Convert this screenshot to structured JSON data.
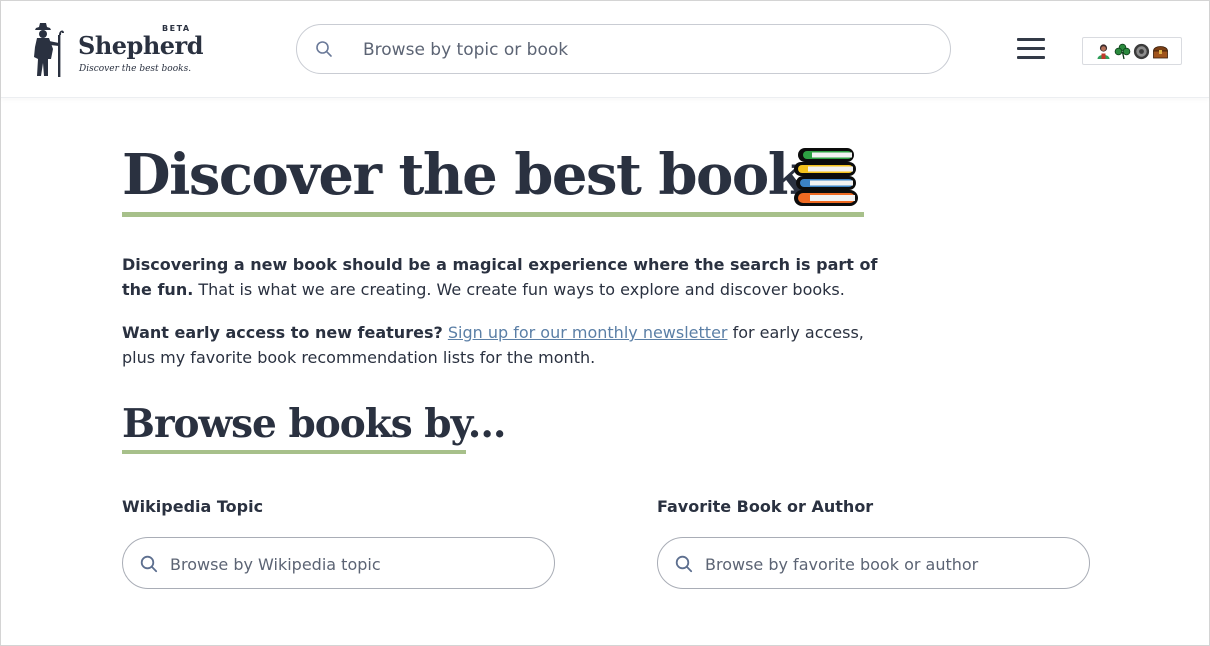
{
  "header": {
    "logo": {
      "name": "Shepherd",
      "badge": "BETA",
      "tagline": "Discover the best books."
    },
    "search": {
      "placeholder": "Browse by topic or book",
      "icon": "search-icon"
    },
    "menu_icon": "hamburger-menu-icon",
    "emoji_badges": [
      "person-icon",
      "shamrock-icon",
      "coin-icon",
      "treasure-chest-icon"
    ]
  },
  "hero": {
    "title": "Discover the best books",
    "title_icon": "books-stack-icon",
    "intro_bold": "Discovering a new book should be a magical experience where the search is part of the fun.",
    "intro_rest": " That is what we are creating. We create fun ways to explore and discover books.",
    "newsletter_bold": "Want early access to new features?",
    "newsletter_link": "Sign up for our monthly newsletter",
    "newsletter_rest": " for early access, plus my favorite book recommendation lists for the month."
  },
  "browse": {
    "title": "Browse books by...",
    "wikipedia": {
      "label": "Wikipedia Topic",
      "placeholder": "Browse by Wikipedia topic"
    },
    "favorite": {
      "label": "Favorite Book or Author",
      "placeholder": "Browse by favorite book or author"
    }
  },
  "colors": {
    "text": "#2a3140",
    "accent_underline": "#a7c08a",
    "link": "#5b7fa6",
    "placeholder": "#5c6474",
    "input_border": "#a9adb6"
  }
}
